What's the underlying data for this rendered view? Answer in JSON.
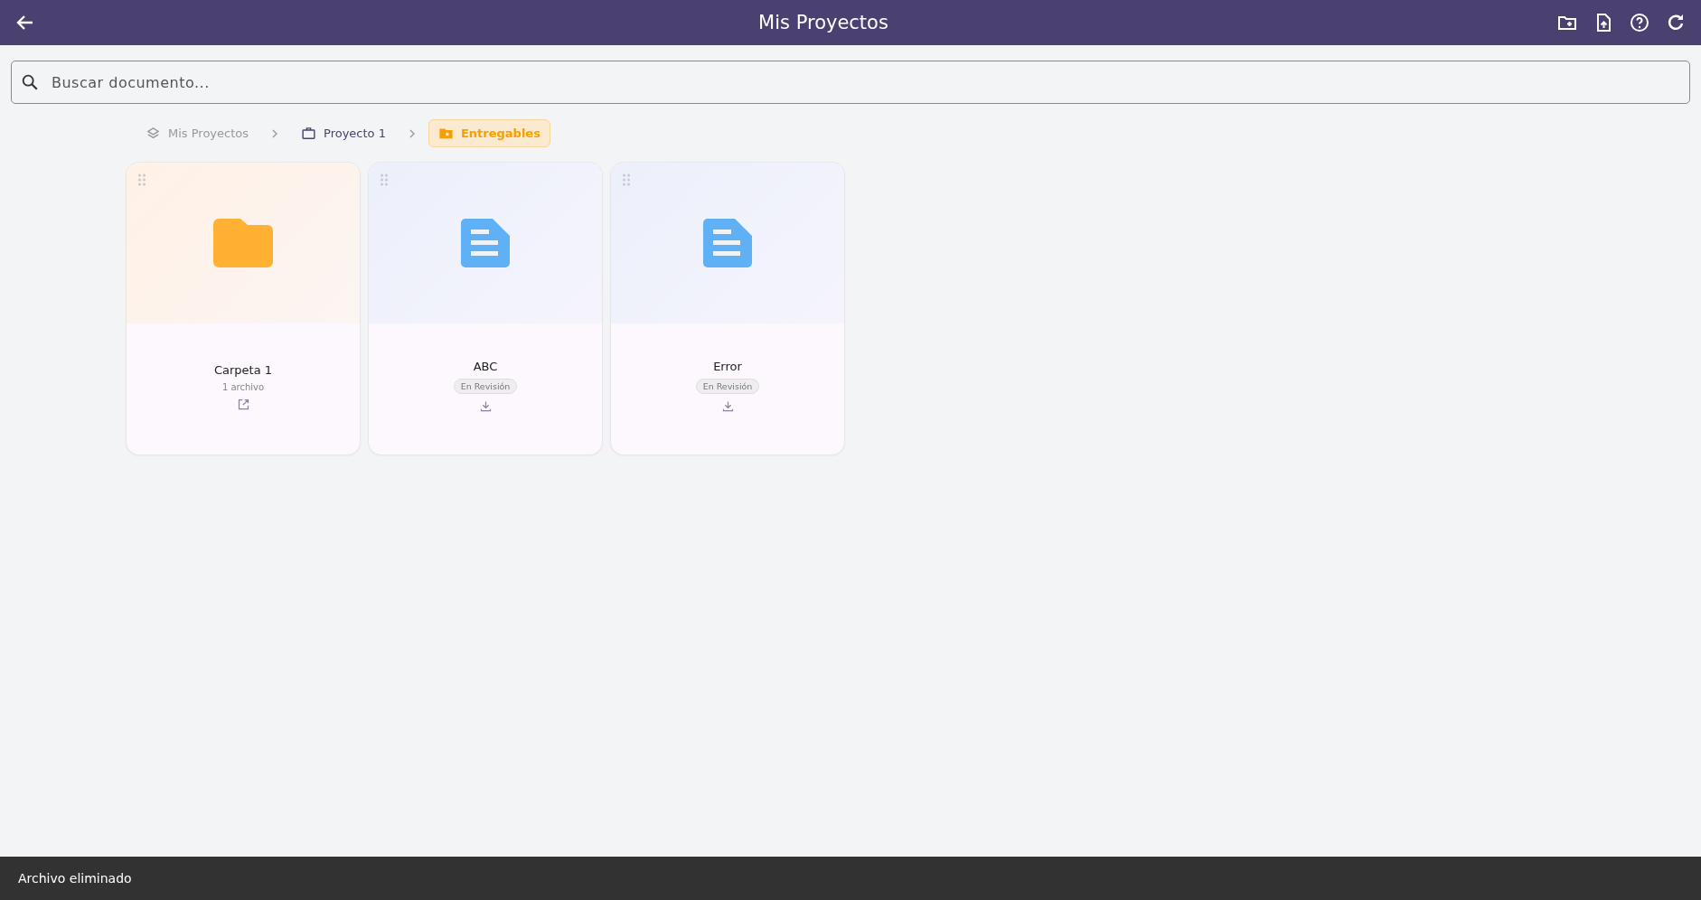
{
  "header": {
    "title": "Mis Proyectos",
    "actions": [
      {
        "kind": "new-folder"
      },
      {
        "kind": "upload-file"
      },
      {
        "kind": "help"
      },
      {
        "kind": "refresh"
      }
    ]
  },
  "search": {
    "placeholder": "Buscar documento..."
  },
  "breadcrumb": [
    {
      "label": "Mis Proyectos",
      "kind": "root",
      "selected": false
    },
    {
      "label": "Proyecto 1",
      "kind": "project",
      "selected": false
    },
    {
      "label": "Entregables",
      "kind": "folder",
      "selected": true
    }
  ],
  "items": [
    {
      "kind": "folder",
      "name": "Carpeta 1",
      "subtitle": "1 archivo"
    },
    {
      "kind": "document",
      "name": "ABC",
      "status": "En Revisión"
    },
    {
      "kind": "document",
      "name": "Error",
      "status": "En Revisión"
    }
  ],
  "snackbar": {
    "message": "Archivo eliminado"
  }
}
